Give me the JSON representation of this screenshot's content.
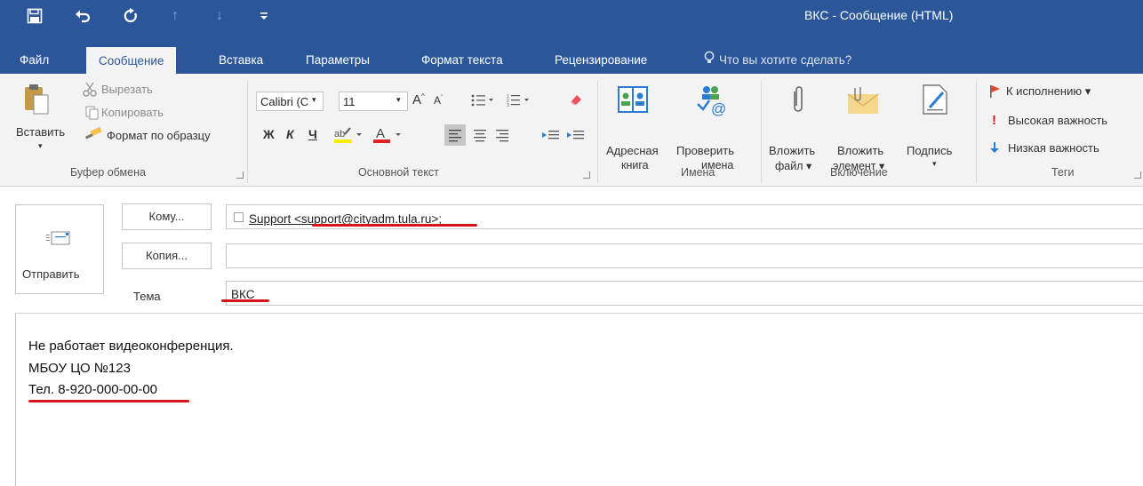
{
  "window": {
    "title": "ВКС - Сообщение (HTML)"
  },
  "quick_access": {
    "save_icon": "save-icon",
    "undo_icon": "undo-icon",
    "redo_icon": "redo-icon",
    "up_icon": "arrow-up-icon",
    "down_icon": "arrow-down-icon",
    "customize_icon": "customize-qat-icon"
  },
  "tabs": [
    {
      "label": "Файл"
    },
    {
      "label": "Сообщение"
    },
    {
      "label": "Вставка"
    },
    {
      "label": "Параметры"
    },
    {
      "label": "Формат текста"
    },
    {
      "label": "Рецензирование"
    }
  ],
  "tell_me": "Что вы хотите сделать?",
  "ribbon": {
    "clipboard": {
      "paste": "Вставить",
      "cut": "Вырезать",
      "copy": "Копировать",
      "format_painter": "Формат по образцу",
      "group": "Буфер обмена"
    },
    "basic_text": {
      "font_name": "Calibri (С",
      "font_size": "11",
      "bold": "Ж",
      "italic": "К",
      "underline": "Ч",
      "grow": "A",
      "shrink": "A",
      "font_color_letter": "A",
      "group": "Основной текст"
    },
    "names": {
      "address_book_1": "Адресная",
      "address_book_2": "книга",
      "check_names_1": "Проверить",
      "check_names_2": "имена",
      "group": "Имена"
    },
    "include": {
      "attach_file_1": "Вложить",
      "attach_file_2": "файл",
      "attach_item_1": "Вложить",
      "attach_item_2": "элемент",
      "signature": "Подпись",
      "group": "Включение"
    },
    "tags": {
      "follow_up": "К исполнению",
      "high": "Высокая важность",
      "low": "Низкая важность",
      "group": "Теги"
    }
  },
  "compose": {
    "send": "Отправить",
    "to_button": "Кому...",
    "cc_button": "Копия...",
    "subject_label": "Тема",
    "recipient": "Support <support@cityadm.tula.ru>;",
    "cc_value": "",
    "subject": "ВКС"
  },
  "body": {
    "lines": [
      "Не работает видеоконференция.",
      "МБОУ ЦО №123",
      "Тел. 8-920-000-00-00"
    ]
  },
  "colors": {
    "accent": "#2b579a",
    "ribbon_bg": "#f3f3f3",
    "annotation_red": "#d7141a"
  }
}
